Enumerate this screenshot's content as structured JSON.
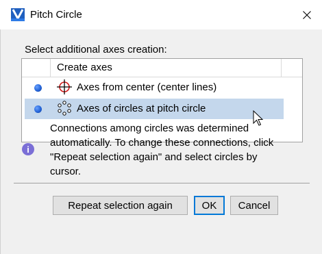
{
  "window": {
    "title": "Pitch Circle",
    "close_icon": "close-icon",
    "app_icon": "app-logo-icon"
  },
  "dialog": {
    "prompt": "Select additional axes creation:",
    "list": {
      "header": "Create axes",
      "rows": [
        {
          "label": "Axes from center (center lines)",
          "icon": "crosshair-icon",
          "selected": false
        },
        {
          "label": "Axes of circles at pitch circle",
          "icon": "circle-pattern-icon",
          "selected": true
        }
      ]
    },
    "info_icon": "info-icon",
    "info_text": [
      "Connections among circles was determined",
      "automatically. To change these connections, click",
      "\"Repeat selection again\" and select circles by",
      "cursor."
    ]
  },
  "buttons": {
    "repeat": "Repeat selection again",
    "ok": "OK",
    "cancel": "Cancel"
  },
  "colors": {
    "selection": "#c4d7ec",
    "default_button_border": "#0078d7",
    "info_icon_bg": "#7b6fd6",
    "crosshair_red": "#d01818"
  }
}
